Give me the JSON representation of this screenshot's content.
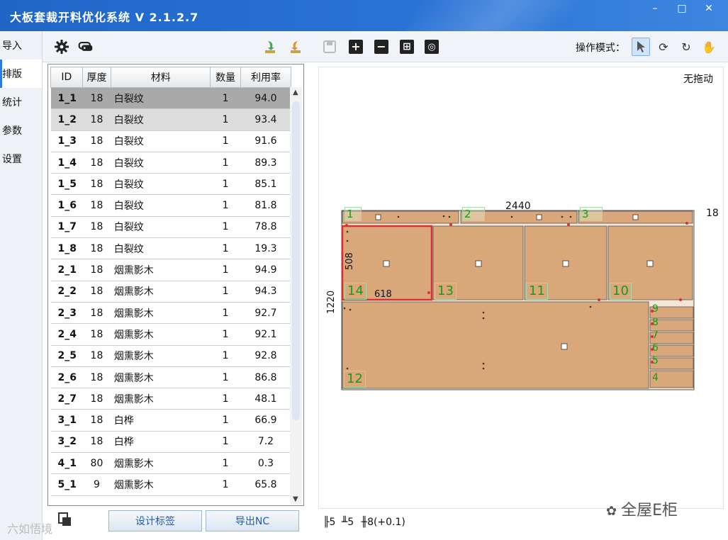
{
  "window": {
    "title": "大板套裁开料优化系统 V 2.1.2.7",
    "min": "–",
    "max": "□",
    "close": "✕"
  },
  "sidebar": {
    "items": [
      {
        "label": "导入"
      },
      {
        "label": "排版"
      },
      {
        "label": "统计"
      },
      {
        "label": "参数"
      },
      {
        "label": "设置"
      }
    ],
    "active": 1
  },
  "toolbar": {
    "mode_label": "操作模式：",
    "icons": [
      "gear-icon",
      "tag-icon",
      "import-green-icon",
      "import-orange-icon",
      "save-icon",
      "plus-icon",
      "minus-icon",
      "add-sheet-icon",
      "search-icon"
    ],
    "modes": [
      "pointer-mode-icon",
      "rotate-cw-icon",
      "rotate-ccw-icon",
      "hand-mode-icon"
    ]
  },
  "table": {
    "headers": [
      "ID",
      "厚度",
      "材料",
      "数量",
      "利用率"
    ],
    "rows": [
      [
        "1_1",
        "18",
        "白裂纹",
        "1",
        "94.0"
      ],
      [
        "1_2",
        "18",
        "白裂纹",
        "1",
        "93.4"
      ],
      [
        "1_3",
        "18",
        "白裂纹",
        "1",
        "91.6"
      ],
      [
        "1_4",
        "18",
        "白裂纹",
        "1",
        "89.3"
      ],
      [
        "1_5",
        "18",
        "白裂纹",
        "1",
        "85.1"
      ],
      [
        "1_6",
        "18",
        "白裂纹",
        "1",
        "81.8"
      ],
      [
        "1_7",
        "18",
        "白裂纹",
        "1",
        "78.8"
      ],
      [
        "1_8",
        "18",
        "白裂纹",
        "1",
        "19.3"
      ],
      [
        "2_1",
        "18",
        "烟熏影木",
        "1",
        "94.9"
      ],
      [
        "2_2",
        "18",
        "烟熏影木",
        "1",
        "94.3"
      ],
      [
        "2_3",
        "18",
        "烟熏影木",
        "1",
        "92.7"
      ],
      [
        "2_4",
        "18",
        "烟熏影木",
        "1",
        "92.1"
      ],
      [
        "2_5",
        "18",
        "烟熏影木",
        "1",
        "92.8"
      ],
      [
        "2_6",
        "18",
        "烟熏影木",
        "1",
        "86.8"
      ],
      [
        "2_7",
        "18",
        "烟熏影木",
        "1",
        "48.1"
      ],
      [
        "3_1",
        "18",
        "白桦",
        "1",
        "66.9"
      ],
      [
        "3_2",
        "18",
        "白桦",
        "1",
        "7.2"
      ],
      [
        "4_1",
        "80",
        "烟熏影木",
        "1",
        "0.3"
      ],
      [
        "5_1",
        "9",
        "烟熏影木",
        "1",
        "65.8"
      ]
    ],
    "selected_row": 0,
    "hover_row": 1
  },
  "buttons": {
    "design_label": "设计标签",
    "export_nc": "导出NC"
  },
  "canvas": {
    "drag_status": "无拖动",
    "sheet_width": "2440",
    "sheet_height": "1220",
    "thickness": "18",
    "part_width": "618",
    "part_height": "508",
    "parts": [
      "1",
      "2",
      "3",
      "14",
      "13",
      "11",
      "10",
      "12",
      "9",
      "8",
      "7",
      "6",
      "5",
      "4"
    ],
    "panel_color": "#d9a77a",
    "highlight_color": "#d93030",
    "label_color": "#1a9a1a"
  },
  "statusbar": {
    "a": "5",
    "b": "5",
    "c": "8(+0.1)"
  },
  "watermark": {
    "brand": "全屋E柜",
    "corner": "六如悟境"
  }
}
